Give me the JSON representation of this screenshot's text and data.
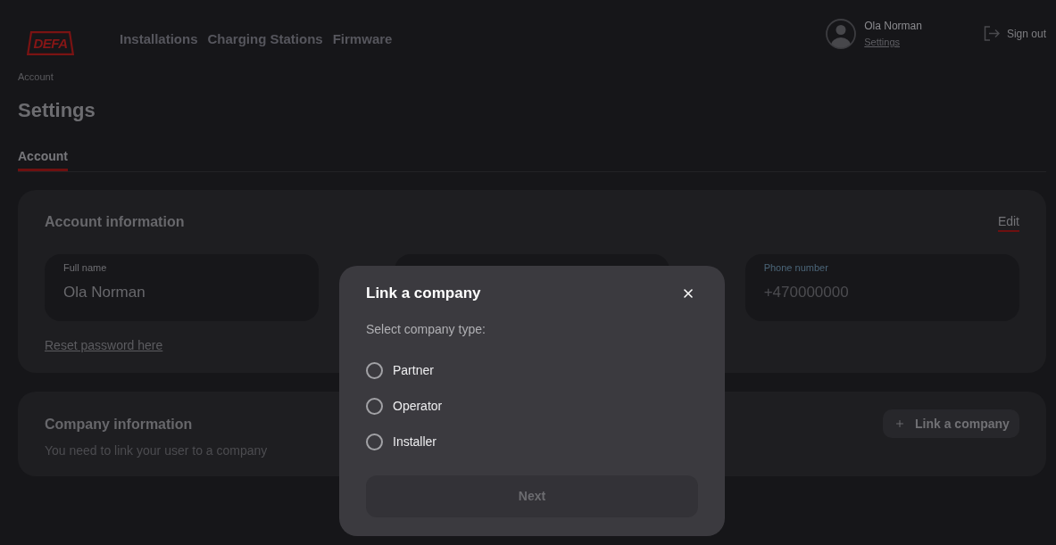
{
  "header": {
    "logo": "DEFA",
    "nav": [
      "Installations",
      "Charging Stations",
      "Firmware"
    ],
    "user": {
      "name": "Ola Norman",
      "settings_link": "Settings"
    },
    "sign_out": "Sign out"
  },
  "breadcrumb": [
    "Account"
  ],
  "title": "Settings",
  "tabs": [
    {
      "label": "Account",
      "selected": true
    }
  ],
  "account_information": {
    "title": "Account information",
    "edit": "Edit",
    "fields": [
      {
        "label": "Full name",
        "value": "Ola Norman"
      },
      {
        "label": "Phone number",
        "placeholder": "+470000000"
      }
    ],
    "reset_password_link": "Reset password here"
  },
  "company_information": {
    "title": "Company information",
    "message": "You need to link your user to a company",
    "link_button": "Link a company"
  },
  "dialog": {
    "title": "Link a company",
    "prompt": "Select company type:",
    "options": [
      {
        "label": "Partner",
        "selected": false
      },
      {
        "label": "Operator",
        "selected": false
      },
      {
        "label": "Installer",
        "selected": false
      }
    ],
    "next_button": {
      "label": "Next",
      "disabled": true
    }
  }
}
